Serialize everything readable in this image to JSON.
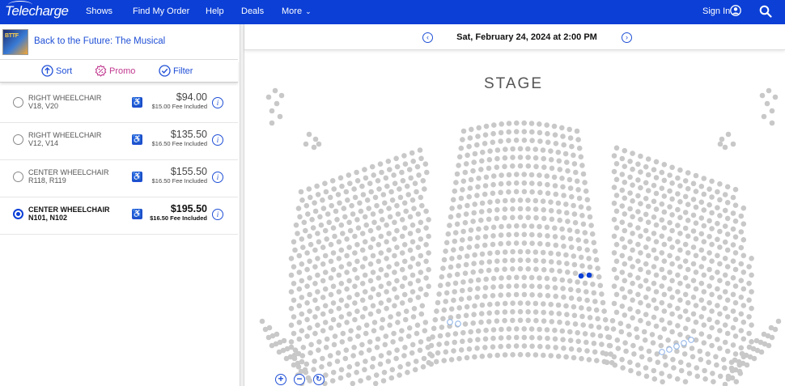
{
  "brand": "Telecharge",
  "nav": {
    "shows": "Shows",
    "find_order": "Find My Order",
    "help": "Help",
    "deals": "Deals",
    "more": "More",
    "sign_in": "Sign In"
  },
  "show": {
    "title": "Back to the Future: The Musical",
    "thumb_text": "BTTF"
  },
  "toolbar": {
    "sort": "Sort",
    "promo": "Promo",
    "filter": "Filter"
  },
  "tickets": [
    {
      "name": "RIGHT WHEELCHAIR",
      "seats": "V18, V20",
      "price": "$94.00",
      "fee": "$15.00 Fee Included",
      "selected": false
    },
    {
      "name": "RIGHT WHEELCHAIR",
      "seats": "V12, V14",
      "price": "$135.50",
      "fee": "$16.50 Fee Included",
      "selected": false
    },
    {
      "name": "CENTER WHEELCHAIR",
      "seats": "R118, R119",
      "price": "$155.50",
      "fee": "$16.50 Fee Included",
      "selected": false
    },
    {
      "name": "CENTER WHEELCHAIR",
      "seats": "N101, N102",
      "price": "$195.50",
      "fee": "$16.50 Fee Included",
      "selected": true
    }
  ],
  "performance": {
    "date": "Sat, February 24, 2024 at 2:00 PM"
  },
  "seatmap": {
    "stage_label": "STAGE",
    "colors": {
      "available": "#c8c8c8",
      "selected": "#0b3fd6",
      "wheelchair": "#8ab0e8"
    }
  },
  "colors": {
    "brand": "#0b3fd6",
    "link": "#1f4fd6"
  },
  "icons": [
    "user-icon",
    "search-icon",
    "sort-icon",
    "promo-icon",
    "filter-icon",
    "wheelchair-icon",
    "info-icon",
    "zoom-in-icon",
    "zoom-out-icon",
    "reset-icon"
  ]
}
